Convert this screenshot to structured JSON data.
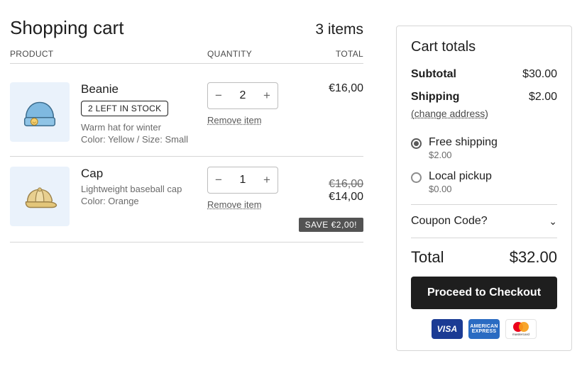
{
  "header": {
    "title": "Shopping cart",
    "item_count": "3 items"
  },
  "columns": {
    "product": "PRODUCT",
    "quantity": "QUANTITY",
    "total": "TOTAL"
  },
  "lines": [
    {
      "name": "Beanie",
      "stock_badge": "2 LEFT IN STOCK",
      "desc": "Warm hat for winter",
      "variant": "Color: Yellow / Size: Small",
      "qty": "2",
      "remove": "Remove item",
      "total": "€16,00"
    },
    {
      "name": "Cap",
      "desc": "Lightweight baseball cap",
      "variant": "Color: Orange",
      "qty": "1",
      "remove": "Remove item",
      "was": "€16,00",
      "now": "€14,00",
      "save_badge": "SAVE €2,00!"
    }
  ],
  "totals": {
    "title": "Cart totals",
    "subtotal_label": "Subtotal",
    "subtotal": "$30.00",
    "shipping_label": "Shipping",
    "shipping": "$2.00",
    "change_address": "(change address)",
    "options": [
      {
        "label": "Free shipping",
        "price": "$2.00",
        "selected": true
      },
      {
        "label": "Local pickup",
        "price": "$0.00",
        "selected": false
      }
    ],
    "coupon": "Coupon Code?",
    "total_label": "Total",
    "total": "$32.00",
    "checkout": "Proceed to Checkout",
    "cards": {
      "visa": "VISA",
      "amex_l1": "AMERICAN",
      "amex_l2": "EXPRESS",
      "mc": "mastercard"
    }
  },
  "icons": {
    "minus": "−",
    "plus": "+",
    "chev": "⌄"
  }
}
